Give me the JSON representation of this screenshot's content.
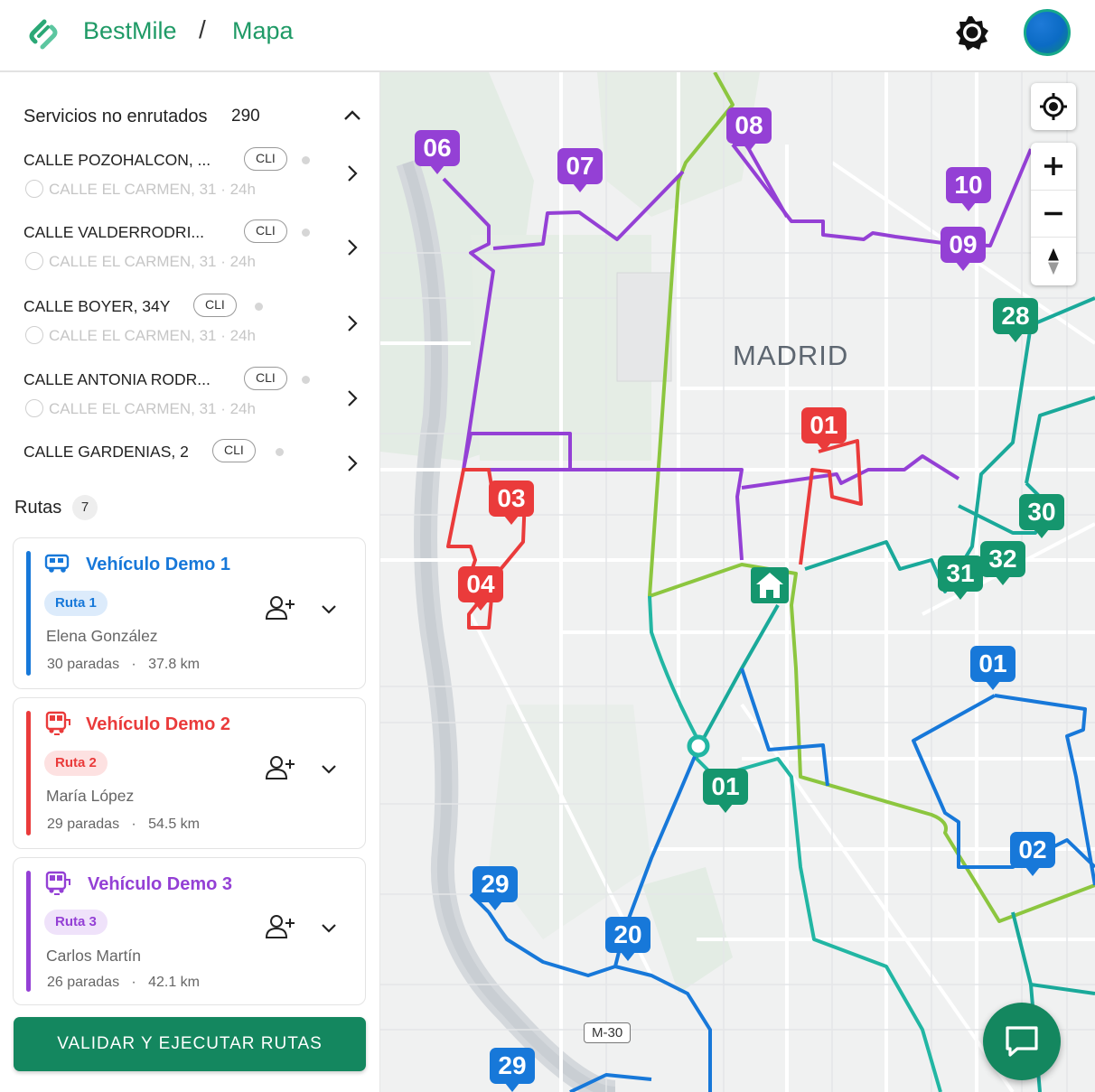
{
  "header": {
    "brand": "BestMile",
    "separator": "/",
    "breadcrumb": "Mapa"
  },
  "unrouted": {
    "title": "Servicios no enrutados",
    "count": "290",
    "items": [
      {
        "name": "CALLE POZOHALCON, ...",
        "chip": "CLI",
        "sub": "CALLE EL CARMEN, 31 · 24h"
      },
      {
        "name": "CALLE VALDERRODRI...",
        "chip": "CLI",
        "sub": "CALLE EL CARMEN, 31 · 24h"
      },
      {
        "name": "CALLE BOYER, 34Y",
        "chip": "CLI",
        "sub": "CALLE EL CARMEN, 31 · 24h"
      },
      {
        "name": "CALLE ANTONIA RODR...",
        "chip": "CLI",
        "sub": "CALLE EL CARMEN, 31 · 24h"
      },
      {
        "name": "CALLE GARDENIAS, 2",
        "chip": "CLI",
        "sub": ""
      }
    ]
  },
  "routes": {
    "title": "Rutas",
    "count": "7",
    "cards": [
      {
        "vehicle": "Vehículo Demo 1",
        "route": "Ruta 1",
        "driver": "Elena González",
        "stops": "30 paradas",
        "distance": "37.8 km",
        "color": "#1778d9",
        "badge_bg": "#dcebfb"
      },
      {
        "vehicle": "Vehículo Demo 2",
        "route": "Ruta 2",
        "driver": "María López",
        "stops": "29 paradas",
        "distance": "54.5 km",
        "color": "#ea3b3b",
        "badge_bg": "#fde1e1"
      },
      {
        "vehicle": "Vehículo Demo 3",
        "route": "Ruta 3",
        "driver": "Carlos Martín",
        "stops": "26 paradas",
        "distance": "42.1 km",
        "color": "#9440d5",
        "badge_bg": "#efe2fa"
      }
    ],
    "stats_separator": "·"
  },
  "validate_button": "VALIDAR Y EJECUTAR RUTAS",
  "map": {
    "city_label": "MADRID",
    "road_label": "M-30",
    "markers": {
      "purple": [
        "06",
        "07",
        "08",
        "10",
        "09"
      ],
      "red": [
        "01",
        "03",
        "04"
      ],
      "teal": [
        "28",
        "30",
        "31",
        "32",
        "01"
      ],
      "blue": [
        "01",
        "02",
        "29",
        "20",
        "29"
      ]
    },
    "colors": {
      "purple": "#9440d5",
      "red": "#ea3b3b",
      "teal": "#15966e",
      "blue": "#1778d9",
      "green": "#8cc63f",
      "brand": "#14875f"
    },
    "icons": [
      "locate-icon",
      "zoom-in-icon",
      "zoom-out-icon",
      "compass-icon",
      "chat-icon",
      "home-icon"
    ]
  }
}
